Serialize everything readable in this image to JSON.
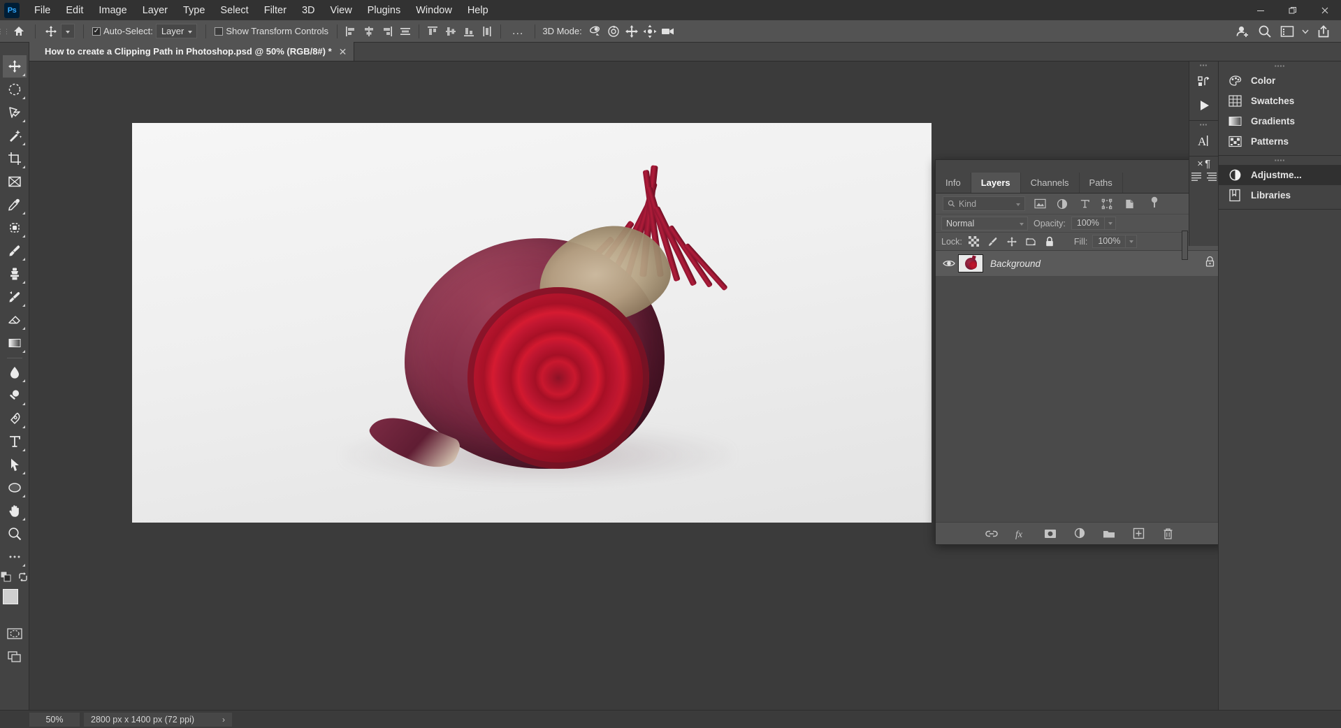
{
  "app": {
    "name": "Adobe Photoshop",
    "logo_text": "Ps"
  },
  "menubar": {
    "items": [
      "File",
      "Edit",
      "Image",
      "Layer",
      "Type",
      "Select",
      "Filter",
      "3D",
      "View",
      "Plugins",
      "Window",
      "Help"
    ],
    "window_controls": {
      "minimize": "minimize-icon",
      "restore": "restore-icon",
      "close": "close-icon"
    }
  },
  "options_bar": {
    "home_icon": "home-icon",
    "tool_icon": "move-tool-icon",
    "auto_select_label": "Auto-Select:",
    "auto_select_checked": true,
    "auto_select_scope": "Layer",
    "show_transform_label": "Show Transform Controls",
    "show_transform_checked": false,
    "align_left_edges": "align-left-edges-icon",
    "align_horizontal_centers": "align-horizontal-centers-icon",
    "align_right_edges": "align-right-edges-icon",
    "distribute_horizontally": "distribute-horizontally-icon",
    "align_top_edges": "align-top-edges-icon",
    "align_vertical_centers": "align-vertical-centers-icon",
    "align_bottom_edges": "align-bottom-edges-icon",
    "distribute_vertically": "distribute-vertically-icon",
    "more_options": "...",
    "mode_3d_label": "3D Mode:",
    "mode_3d_icons": [
      "orbit-3d-icon",
      "roll-3d-icon",
      "pan-3d-icon",
      "slide-3d-icon",
      "camera-3d-icon"
    ],
    "right_icons": [
      "share-user-icon",
      "search-icon",
      "workspace-icon",
      "chevron-down-icon",
      "share-export-icon"
    ]
  },
  "toolbar": {
    "grip": "toolbar-grip",
    "tools": [
      {
        "name": "move-tool",
        "icon": "move-icon",
        "active": true,
        "corner": true
      },
      {
        "name": "marquee-tool",
        "icon": "elliptical-marquee-icon",
        "corner": true
      },
      {
        "name": "lasso-tool",
        "icon": "polygonal-lasso-icon",
        "corner": true
      },
      {
        "name": "magic-wand-tool",
        "icon": "object-selection-icon",
        "corner": true
      },
      {
        "name": "crop-tool",
        "icon": "crop-icon",
        "corner": true
      },
      {
        "name": "frame-tool",
        "icon": "frame-icon",
        "corner": false
      },
      {
        "name": "eyedropper-tool",
        "icon": "eyedropper-icon",
        "corner": true
      },
      {
        "name": "spot-healing-tool",
        "icon": "healing-brush-icon",
        "corner": true
      },
      {
        "name": "brush-tool",
        "icon": "brush-icon",
        "corner": true
      },
      {
        "name": "clone-stamp-tool",
        "icon": "clone-stamp-icon",
        "corner": true
      },
      {
        "name": "history-brush-tool",
        "icon": "history-brush-icon",
        "corner": true
      },
      {
        "name": "eraser-tool",
        "icon": "eraser-icon",
        "corner": true
      },
      {
        "name": "gradient-tool",
        "icon": "gradient-icon",
        "corner": true
      },
      {
        "name": "blur-tool",
        "icon": "blur-drop-icon",
        "corner": true
      },
      {
        "name": "dodge-tool",
        "icon": "dodge-icon",
        "corner": true
      },
      {
        "name": "pen-tool",
        "icon": "pen-icon",
        "corner": true
      },
      {
        "name": "type-tool",
        "icon": "type-icon",
        "corner": true
      },
      {
        "name": "path-selection-tool",
        "icon": "path-select-arrow-icon",
        "corner": true
      },
      {
        "name": "shape-tool",
        "icon": "ellipse-shape-icon",
        "corner": true
      },
      {
        "name": "hand-tool",
        "icon": "hand-icon",
        "corner": true
      },
      {
        "name": "zoom-tool",
        "icon": "zoom-magnifier-icon",
        "corner": false
      },
      {
        "name": "edit-toolbar",
        "icon": "more-dots-icon",
        "corner": true
      }
    ],
    "default_colors_icon": "default-colors-icon",
    "swap_colors_icon": "swap-colors-icon",
    "foreground_color": "#cfcfcf",
    "background_color": "#9dbfb0",
    "quick_mask_icon": "quick-mask-icon",
    "screen_mode_icon": "screen-mode-icon"
  },
  "document_tab": {
    "title": "How to create a Clipping Path in Photoshop.psd @ 50% (RGB/8#) *",
    "close_icon": "close-icon"
  },
  "status_bar": {
    "zoom": "50%",
    "doc_size": "2800 px x 1400 px (72 ppi)",
    "expand_arrow": "›"
  },
  "layers_panel": {
    "collapse_icon": "collapse-panel-icon",
    "close_icon": "close-icon",
    "tabs": [
      {
        "label": "Info",
        "active": false
      },
      {
        "label": "Layers",
        "active": true
      },
      {
        "label": "Channels",
        "active": false
      },
      {
        "label": "Paths",
        "active": false
      }
    ],
    "menu_icon": "panel-menu-icon",
    "filter": {
      "kind_label": "Kind",
      "search_icon": "search-icon",
      "filter_icons": [
        "pixel-filter-icon",
        "adjustment-filter-icon",
        "type-filter-icon",
        "shape-filter-icon",
        "smart-object-filter-icon"
      ],
      "toggle_icon": "filter-toggle-icon"
    },
    "blend_mode": "Normal",
    "opacity_label": "Opacity:",
    "opacity_value": "100%",
    "lock_label": "Lock:",
    "lock_icons": [
      "lock-transparent-pixels-icon",
      "lock-image-pixels-icon",
      "lock-position-icon",
      "lock-artboard-icon",
      "lock-all-icon"
    ],
    "fill_label": "Fill:",
    "fill_value": "100%",
    "layers": [
      {
        "name": "Background",
        "visible": true,
        "locked": true,
        "selected": true,
        "visibility_icon": "eye-icon",
        "lock_icon": "lock-icon",
        "thumbnail": "beetroot-thumbnail"
      }
    ],
    "bottom_buttons": [
      {
        "name": "link-layers-button",
        "icon": "link-icon"
      },
      {
        "name": "layer-style-button",
        "icon": "fx-icon"
      },
      {
        "name": "layer-mask-button",
        "icon": "mask-icon"
      },
      {
        "name": "new-adjustment-layer-button",
        "icon": "adjustment-icon"
      },
      {
        "name": "new-group-button",
        "icon": "folder-icon"
      },
      {
        "name": "new-layer-button",
        "icon": "new-layer-icon"
      },
      {
        "name": "delete-layer-button",
        "icon": "trash-icon"
      }
    ]
  },
  "right_dock": {
    "strip_groups": [
      {
        "icons": [
          "history-icon",
          "actions-play-icon"
        ]
      },
      {
        "icons": [
          "character-icon"
        ]
      },
      {
        "icons": [
          "paragraph-icon",
          "paragraph-styles-icon"
        ]
      }
    ],
    "sections": [
      {
        "items": [
          {
            "label": "Color",
            "icon": "color-wheel-icon",
            "active": false
          },
          {
            "label": "Swatches",
            "icon": "swatches-grid-icon",
            "active": false
          },
          {
            "label": "Gradients",
            "icon": "gradient-icon",
            "active": false
          },
          {
            "label": "Patterns",
            "icon": "patterns-icon",
            "active": false
          }
        ]
      },
      {
        "items": [
          {
            "label": "Adjustme...",
            "icon": "adjustment-icon",
            "active": true
          },
          {
            "label": "Libraries",
            "icon": "libraries-book-icon",
            "active": false
          }
        ]
      }
    ]
  },
  "canvas": {
    "image_alt": "beetroot-photograph",
    "colors": {
      "beet_dark": "#7d2340",
      "beet_cut": "#c4172e",
      "crown": "#b6a384",
      "background": "#f0f0f0"
    }
  }
}
